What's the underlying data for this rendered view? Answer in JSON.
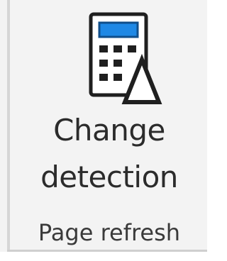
{
  "ribbon_group": {
    "button": {
      "label_line1": "Change",
      "label_line2": "detection",
      "icon": "calculator-change-detection-icon"
    },
    "group_label": "Page refresh"
  },
  "colors": {
    "panel_bg": "#f3f3f3",
    "icon_stroke": "#1f1f1f",
    "icon_accent": "#1e88e5",
    "text": "#2b2b2b"
  }
}
